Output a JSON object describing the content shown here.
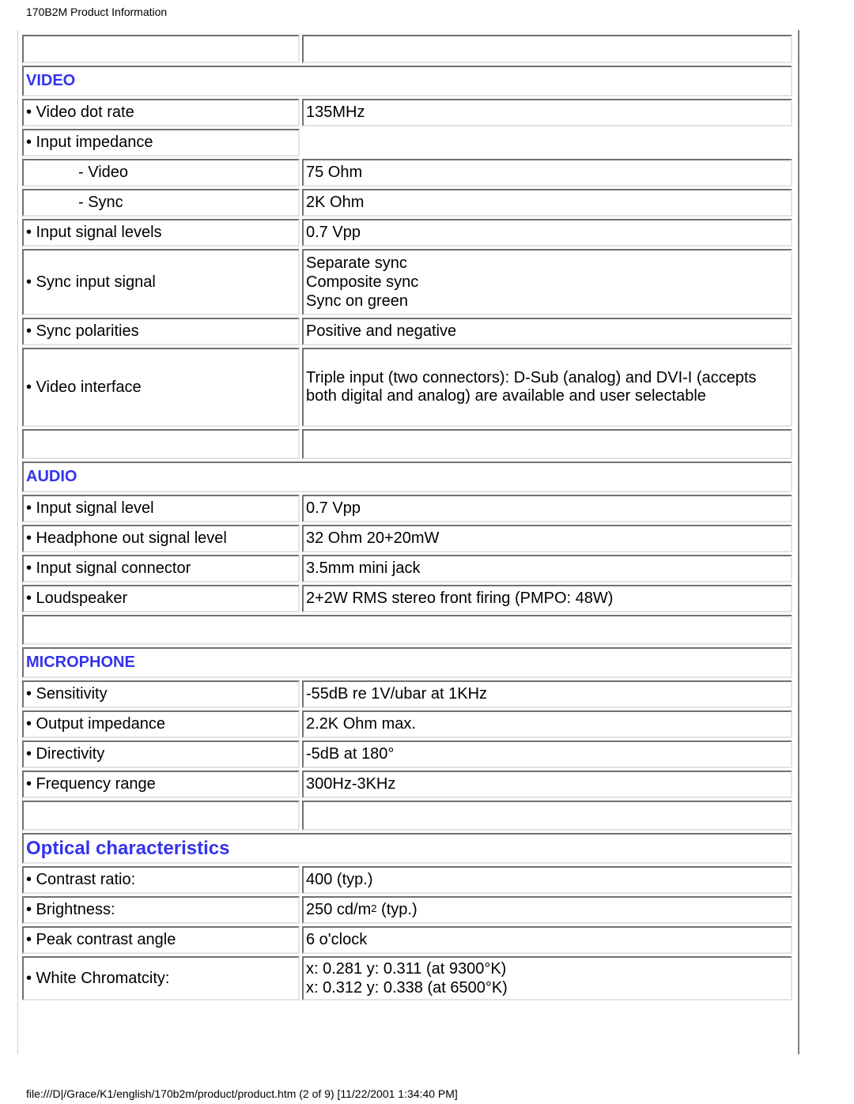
{
  "header": {
    "title": "170B2M Product Information"
  },
  "footer": {
    "path": "file:///D|/Grace/K1/english/170b2m/product/product.htm (2 of 9) [11/22/2001 1:34:40 PM]"
  },
  "colors": {
    "heading": "#3333ee"
  },
  "video": {
    "heading": "VIDEO",
    "rows": [
      {
        "label": "• Video dot rate",
        "value": "135MHz"
      },
      {
        "label": "• Input impedance",
        "value": ""
      },
      {
        "label": "- Video",
        "value": "75 Ohm"
      },
      {
        "label": "- Sync",
        "value": "2K Ohm"
      },
      {
        "label": "• Input signal levels",
        "value": "0.7 Vpp"
      },
      {
        "label": "• Sync input signal",
        "values": [
          "Separate sync",
          "Composite sync",
          "Sync on green"
        ]
      },
      {
        "label": "• Sync polarities",
        "value": "Positive and negative"
      },
      {
        "label": "• Video interface",
        "value": "Triple input (two connectors): D-Sub (analog) and DVI-I (accepts both digital and analog) are available and user selectable"
      }
    ]
  },
  "audio": {
    "heading": "AUDIO",
    "rows": [
      {
        "label": "• Input signal level",
        "value": "0.7 Vpp"
      },
      {
        "label": "• Headphone out signal level",
        "value": "32 Ohm 20+20mW"
      },
      {
        "label": "• Input signal connector",
        "value": "3.5mm mini jack"
      },
      {
        "label": "• Loudspeaker",
        "value": "2+2W RMS stereo front firing (PMPO: 48W)"
      }
    ]
  },
  "microphone": {
    "heading": "MICROPHONE",
    "rows": [
      {
        "label": "• Sensitivity",
        "value": "-55dB re 1V/ubar at 1KHz"
      },
      {
        "label": "• Output impedance",
        "value": "2.2K Ohm max."
      },
      {
        "label": "• Directivity",
        "value": "-5dB at 180°"
      },
      {
        "label": "• Frequency range",
        "value": "300Hz-3KHz"
      }
    ]
  },
  "optical": {
    "heading": "Optical characteristics",
    "rows": [
      {
        "label": "• Contrast ratio:",
        "value": "400 (typ.)"
      },
      {
        "label": "• Brightness:",
        "value_prefix": "250 cd/m",
        "value_sup": "2",
        "value_suffix": " (typ.)"
      },
      {
        "label": "• Peak contrast angle",
        "value": "6 o'clock"
      },
      {
        "label": "• White Chromatcity:",
        "values": [
          "x: 0.281 y: 0.311 (at 9300°K)",
          "x: 0.312 y: 0.338 (at 6500°K)"
        ]
      }
    ]
  }
}
